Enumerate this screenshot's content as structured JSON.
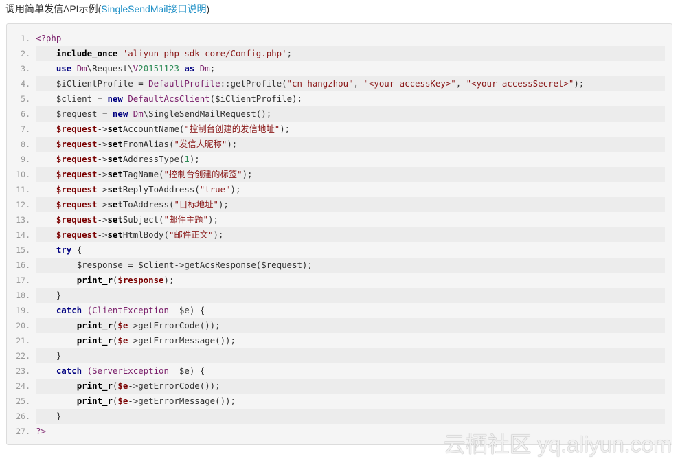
{
  "heading": {
    "prefix": "调用简单发信API示例(",
    "link": "SingleSendMail接口说明",
    "suffix": ")"
  },
  "code": {
    "language": "php",
    "lines": [
      {
        "n": "1.",
        "indent": 0,
        "tokens": [
          [
            "php",
            "<?php"
          ]
        ]
      },
      {
        "n": "2.",
        "indent": 1,
        "tokens": [
          [
            "fn",
            "include_once"
          ],
          [
            "plain",
            " "
          ],
          [
            "str",
            "'aliyun-php-sdk-core/Config.php'"
          ],
          [
            "plain",
            ";"
          ]
        ]
      },
      {
        "n": "3.",
        "indent": 1,
        "tokens": [
          [
            "kw",
            "use"
          ],
          [
            "plain",
            " "
          ],
          [
            "cls",
            "Dm"
          ],
          [
            "plain",
            "\\Request\\"
          ],
          [
            "cls",
            "V"
          ],
          [
            "num",
            "20151123"
          ],
          [
            "plain",
            " "
          ],
          [
            "kw",
            "as"
          ],
          [
            "plain",
            " "
          ],
          [
            "cls",
            "Dm"
          ],
          [
            "plain",
            ";"
          ]
        ]
      },
      {
        "n": "4.",
        "indent": 1,
        "tokens": [
          [
            "plain",
            "$iClientProfile = "
          ],
          [
            "cls",
            "DefaultProfile"
          ],
          [
            "plain",
            "::getProfile("
          ],
          [
            "str",
            "\"cn-hangzhou\""
          ],
          [
            "plain",
            ", "
          ],
          [
            "str",
            "\"<your accessKey>\""
          ],
          [
            "plain",
            ", "
          ],
          [
            "str",
            "\"<your accessSecret>\""
          ],
          [
            "plain",
            ");"
          ]
        ]
      },
      {
        "n": "5.",
        "indent": 1,
        "tokens": [
          [
            "plain",
            "$client = "
          ],
          [
            "kw",
            "new"
          ],
          [
            "plain",
            " "
          ],
          [
            "cls",
            "DefaultAcsClient"
          ],
          [
            "plain",
            "($iClientProfile);"
          ]
        ]
      },
      {
        "n": "6.",
        "indent": 1,
        "tokens": [
          [
            "plain",
            "$request = "
          ],
          [
            "kw",
            "new"
          ],
          [
            "plain",
            " "
          ],
          [
            "cls",
            "Dm"
          ],
          [
            "plain",
            "\\SingleSendMailRequest();"
          ]
        ]
      },
      {
        "n": "7.",
        "indent": 1,
        "tokens": [
          [
            "var",
            "$request"
          ],
          [
            "plain",
            "->"
          ],
          [
            "fn",
            "set"
          ],
          [
            "plain",
            "AccountName("
          ],
          [
            "str",
            "\"控制台创建的发信地址\""
          ],
          [
            "plain",
            ");"
          ]
        ]
      },
      {
        "n": "8.",
        "indent": 1,
        "tokens": [
          [
            "var",
            "$request"
          ],
          [
            "plain",
            "->"
          ],
          [
            "fn",
            "set"
          ],
          [
            "plain",
            "FromAlias("
          ],
          [
            "str",
            "\"发信人昵称\""
          ],
          [
            "plain",
            ");"
          ]
        ]
      },
      {
        "n": "9.",
        "indent": 1,
        "tokens": [
          [
            "var",
            "$request"
          ],
          [
            "plain",
            "->"
          ],
          [
            "fn",
            "set"
          ],
          [
            "plain",
            "AddressType("
          ],
          [
            "num",
            "1"
          ],
          [
            "plain",
            ");"
          ]
        ]
      },
      {
        "n": "10.",
        "indent": 1,
        "tokens": [
          [
            "var",
            "$request"
          ],
          [
            "plain",
            "->"
          ],
          [
            "fn",
            "set"
          ],
          [
            "plain",
            "TagName("
          ],
          [
            "str",
            "\"控制台创建的标签\""
          ],
          [
            "plain",
            ");"
          ]
        ]
      },
      {
        "n": "11.",
        "indent": 1,
        "tokens": [
          [
            "var",
            "$request"
          ],
          [
            "plain",
            "->"
          ],
          [
            "fn",
            "set"
          ],
          [
            "plain",
            "ReplyToAddress("
          ],
          [
            "str",
            "\"true\""
          ],
          [
            "plain",
            ");"
          ]
        ]
      },
      {
        "n": "12.",
        "indent": 1,
        "tokens": [
          [
            "var",
            "$request"
          ],
          [
            "plain",
            "->"
          ],
          [
            "fn",
            "set"
          ],
          [
            "plain",
            "ToAddress("
          ],
          [
            "str",
            "\"目标地址\""
          ],
          [
            "plain",
            ");"
          ]
        ]
      },
      {
        "n": "13.",
        "indent": 1,
        "tokens": [
          [
            "var",
            "$request"
          ],
          [
            "plain",
            "->"
          ],
          [
            "fn",
            "set"
          ],
          [
            "plain",
            "Subject("
          ],
          [
            "str",
            "\"邮件主题\""
          ],
          [
            "plain",
            ");"
          ]
        ]
      },
      {
        "n": "14.",
        "indent": 1,
        "tokens": [
          [
            "var",
            "$request"
          ],
          [
            "plain",
            "->"
          ],
          [
            "fn",
            "set"
          ],
          [
            "plain",
            "HtmlBody("
          ],
          [
            "str",
            "\"邮件正文\""
          ],
          [
            "plain",
            ");"
          ]
        ]
      },
      {
        "n": "15.",
        "indent": 1,
        "tokens": [
          [
            "kw",
            "try"
          ],
          [
            "plain",
            " {"
          ]
        ]
      },
      {
        "n": "16.",
        "indent": 2,
        "tokens": [
          [
            "plain",
            "$response = $client->getAcsResponse($request);"
          ]
        ]
      },
      {
        "n": "17.",
        "indent": 2,
        "tokens": [
          [
            "fn",
            "print_r"
          ],
          [
            "plain",
            "("
          ],
          [
            "var",
            "$response"
          ],
          [
            "plain",
            ");"
          ]
        ]
      },
      {
        "n": "18.",
        "indent": 1,
        "tokens": [
          [
            "plain",
            "}"
          ]
        ]
      },
      {
        "n": "19.",
        "indent": 1,
        "tokens": [
          [
            "kw",
            "catch"
          ],
          [
            "plain",
            " "
          ],
          [
            "cls",
            "(ClientException"
          ],
          [
            "plain",
            "  $e) {"
          ]
        ]
      },
      {
        "n": "20.",
        "indent": 2,
        "tokens": [
          [
            "fn",
            "print_r"
          ],
          [
            "plain",
            "("
          ],
          [
            "var",
            "$e"
          ],
          [
            "plain",
            "->getErrorCode());"
          ]
        ]
      },
      {
        "n": "21.",
        "indent": 2,
        "tokens": [
          [
            "fn",
            "print_r"
          ],
          [
            "plain",
            "("
          ],
          [
            "var",
            "$e"
          ],
          [
            "plain",
            "->getErrorMessage());"
          ]
        ]
      },
      {
        "n": "22.",
        "indent": 1,
        "tokens": [
          [
            "plain",
            "}"
          ]
        ]
      },
      {
        "n": "23.",
        "indent": 1,
        "tokens": [
          [
            "kw",
            "catch"
          ],
          [
            "plain",
            " "
          ],
          [
            "cls",
            "(ServerException"
          ],
          [
            "plain",
            "  $e) {"
          ]
        ]
      },
      {
        "n": "24.",
        "indent": 2,
        "tokens": [
          [
            "fn",
            "print_r"
          ],
          [
            "plain",
            "("
          ],
          [
            "var",
            "$e"
          ],
          [
            "plain",
            "->getErrorCode());"
          ]
        ]
      },
      {
        "n": "25.",
        "indent": 2,
        "tokens": [
          [
            "fn",
            "print_r"
          ],
          [
            "plain",
            "("
          ],
          [
            "var",
            "$e"
          ],
          [
            "plain",
            "->getErrorMessage());"
          ]
        ]
      },
      {
        "n": "26.",
        "indent": 1,
        "tokens": [
          [
            "plain",
            "}"
          ]
        ]
      },
      {
        "n": "27.",
        "indent": 0,
        "tokens": [
          [
            "php",
            "?>"
          ]
        ]
      }
    ]
  },
  "watermark": "云栖社区 yq.aliyun.com"
}
